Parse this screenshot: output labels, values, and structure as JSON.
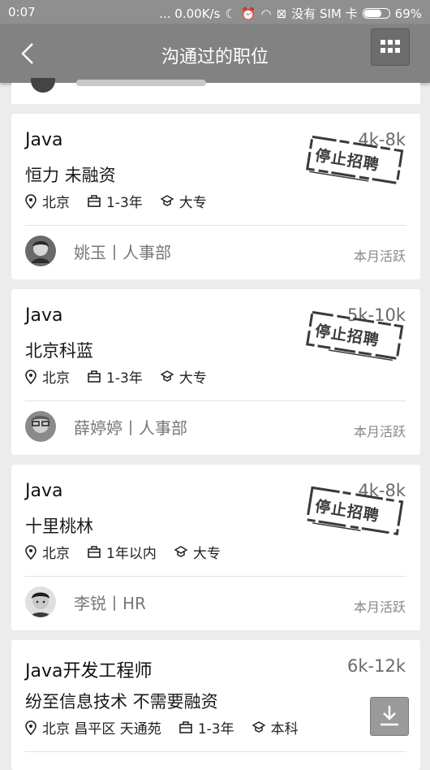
{
  "status_bar": {
    "time": "0:07",
    "network_speed": "... 0.00K/s",
    "sim_status": "没有 SIM 卡",
    "battery": "69%",
    "battery_level": 0.69
  },
  "header": {
    "title": "沟通过的职位"
  },
  "jobs": [
    {
      "title": "Java",
      "salary": "4k-8k",
      "company": "恒力 未融资",
      "location": "北京",
      "experience": "1-3年",
      "education": "大专",
      "stamp": "停止招聘",
      "recruiter": "姚玉丨人事部",
      "activity": "本月活跃"
    },
    {
      "title": "Java",
      "salary": "5k-10k",
      "company": "北京科蓝",
      "location": "北京",
      "experience": "1-3年",
      "education": "大专",
      "stamp": "停止招聘",
      "recruiter": "薛婷婷丨人事部",
      "activity": "本月活跃"
    },
    {
      "title": "Java",
      "salary": "4k-8k",
      "company": "十里桃林",
      "location": "北京",
      "experience": "1年以内",
      "education": "大专",
      "stamp": "停止招聘",
      "recruiter": "李锐丨HR",
      "activity": "本月活跃"
    },
    {
      "title": "Java开发工程师",
      "salary": "6k-12k",
      "company": "纷至信息技术 不需要融资",
      "location": "北京 昌平区 天通苑",
      "experience": "1-3年",
      "education": "本科"
    }
  ]
}
